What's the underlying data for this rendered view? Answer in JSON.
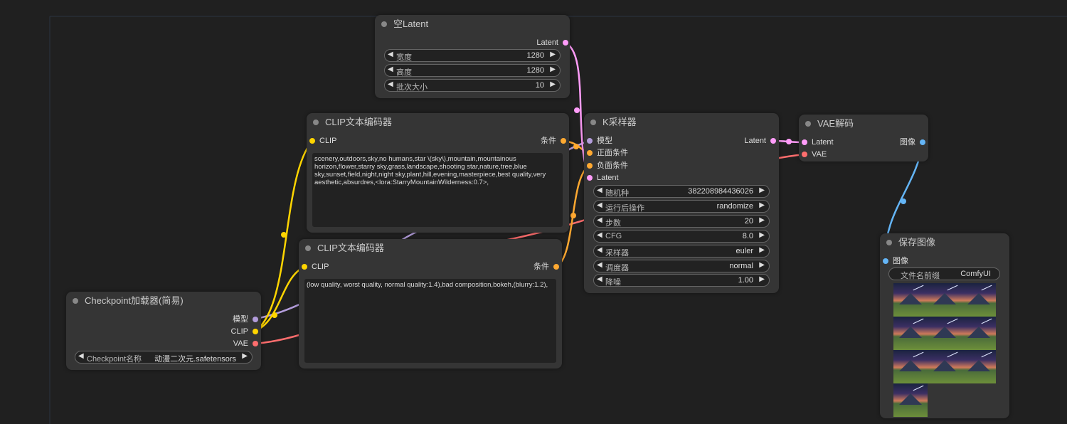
{
  "nodes": {
    "empty_latent": {
      "title": "空Latent",
      "output": "Latent",
      "width": {
        "label": "宽度",
        "value": "1280"
      },
      "height": {
        "label": "高度",
        "value": "1280"
      },
      "batch": {
        "label": "批次大小",
        "value": "10"
      }
    },
    "clip_pos": {
      "title": "CLIP文本编码器",
      "input": "CLIP",
      "output": "条件",
      "text": "scenery,outdoors,sky,no humans,star \\(sky\\),mountain,mountainous horizon,flower,starry sky,grass,landscape,shooting star,nature,tree,blue sky,sunset,field,night,night sky,plant,hill,evening,masterpiece,best quality,very aesthetic,absurdres,<lora:StarryMountainWilderness:0.7>,"
    },
    "clip_neg": {
      "title": "CLIP文本编码器",
      "input": "CLIP",
      "output": "条件",
      "text": "(low quality, worst quality, normal quality:1.4),bad composition,bokeh,(blurry:1.2),"
    },
    "checkpoint": {
      "title": "Checkpoint加载器(简易)",
      "out_model": "模型",
      "out_clip": "CLIP",
      "out_vae": "VAE",
      "ckpt": {
        "label": "Checkpoint名称",
        "value": "动漫二次元.safetensors"
      }
    },
    "ksampler": {
      "title": "K采样器",
      "in_model": "模型",
      "in_pos": "正面条件",
      "in_neg": "负面条件",
      "in_latent": "Latent",
      "output": "Latent",
      "seed": {
        "label": "随机种",
        "value": "382208984436026"
      },
      "control": {
        "label": "运行后操作",
        "value": "randomize"
      },
      "steps": {
        "label": "步数",
        "value": "20"
      },
      "cfg": {
        "label": "CFG",
        "value": "8.0"
      },
      "sampler": {
        "label": "采样器",
        "value": "euler"
      },
      "scheduler": {
        "label": "调度器",
        "value": "normal"
      },
      "denoise": {
        "label": "降噪",
        "value": "1.00"
      }
    },
    "vae_decode": {
      "title": "VAE解码",
      "in_latent": "Latent",
      "in_vae": "VAE",
      "output": "图像"
    },
    "save_image": {
      "title": "保存图像",
      "input": "图像",
      "prefix": {
        "label": "文件名前缀",
        "value": "ComfyUI"
      }
    }
  },
  "colors": {
    "model": "#b39ddb",
    "clip": "#ffd500",
    "vae": "#ff6e6e",
    "conditioning": "#ffa931",
    "latent": "#ff9cf9",
    "image": "#64b5f6"
  }
}
